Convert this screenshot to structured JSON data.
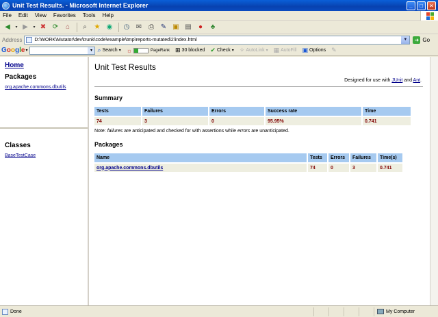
{
  "window": {
    "title": "Unit Test Results. - Microsoft Internet Explorer",
    "minimize": "_",
    "maximize": "□",
    "close": "×"
  },
  "menu": [
    "File",
    "Edit",
    "View",
    "Favorites",
    "Tools",
    "Help"
  ],
  "address": {
    "label": "Address",
    "url": "D:\\WORK\\Mutator\\dev\\trunk\\code\\example\\tmp\\reports-mutated\\2\\index.html",
    "go": "Go"
  },
  "google_toolbar": {
    "logo": [
      "G",
      "o",
      "o",
      "g",
      "l",
      "e"
    ],
    "search": "Search",
    "pagerank": "PageRank",
    "blocked": "30 blocked",
    "check": "Check",
    "autolink": "AutoLink",
    "autofill": "AutoFill",
    "options": "Options"
  },
  "left": {
    "home": "Home",
    "packages_heading": "Packages",
    "packages": [
      "org.apache.commons.dbutils"
    ],
    "classes_heading": "Classes",
    "classes": [
      "BaseTestCase"
    ]
  },
  "main": {
    "title": "Unit Test Results",
    "designed_prefix": "Designed for use with ",
    "junit": "JUnit",
    "and": " and ",
    "ant": "Ant",
    "period": ".",
    "summary_heading": "Summary",
    "summary_headers": [
      "Tests",
      "Failures",
      "Errors",
      "Success rate",
      "Time"
    ],
    "summary_row": [
      "74",
      "3",
      "0",
      "95.95%",
      "0.741"
    ],
    "note_prefix": "Note: ",
    "note_failures": "failures",
    "note_mid": " are anticipated and checked for with assertions while ",
    "note_errors": "errors",
    "note_suffix": " are unanticipated.",
    "packages_heading": "Packages",
    "packages_headers": [
      "Name",
      "Tests",
      "Errors",
      "Failures",
      "Time(s)"
    ],
    "packages_row": [
      "org.apache.commons.dbutils",
      "74",
      "0",
      "3",
      "0.741"
    ]
  },
  "status": {
    "text": "Done",
    "zone": "My Computer"
  }
}
